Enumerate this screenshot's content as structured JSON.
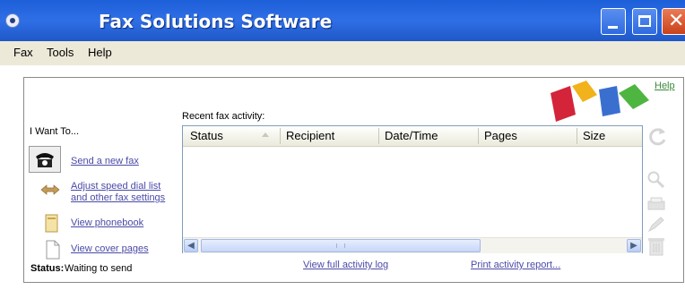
{
  "window": {
    "title": "Fax Solutions Software",
    "controls": {
      "close_glyph": "✕"
    }
  },
  "menu": [
    "Fax",
    "Tools",
    "Help"
  ],
  "help_link": "Help",
  "sidebar": {
    "heading": "I Want To...",
    "tasks": [
      {
        "label": "Send a new fax",
        "icon": "fax-machine-icon"
      },
      {
        "label_line1": "Adjust speed dial list",
        "label_line2": "and other fax settings",
        "icon": "speed-dial-icon"
      },
      {
        "label": "View phonebook",
        "icon": "phonebook-icon"
      },
      {
        "label": "View cover pages",
        "icon": "cover-page-icon"
      }
    ]
  },
  "status": {
    "label": "Status:",
    "value": "Waiting to send"
  },
  "activity": {
    "label": "Recent fax activity:",
    "columns": [
      "Status",
      "Recipient",
      "Date/Time",
      "Pages",
      "Size"
    ],
    "rows": []
  },
  "footer_links": {
    "full_log": "View full activity log",
    "print_report": "Print activity report..."
  },
  "colors": {
    "titlebar": "#2f6fe6",
    "menubar": "#ece9d8",
    "link": "#4a4aa8",
    "help_link": "#3a8a3a",
    "close_button": "#d9532a"
  }
}
